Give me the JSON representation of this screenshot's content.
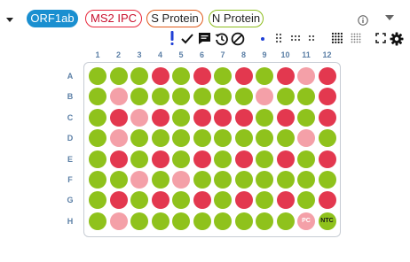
{
  "targets": [
    {
      "label": "ORF1ab",
      "fill": "#1a8fd0",
      "border": "#1a8fd0",
      "text": "#ffffff"
    },
    {
      "label": "MS2 IPC",
      "fill": "#ffffff",
      "border": "#e8273b",
      "text": "#c8102e"
    },
    {
      "label": "S Protein",
      "fill": "#ffffff",
      "border": "#e05a1a",
      "text": "#222222"
    },
    {
      "label": "N Protein",
      "fill": "#ffffff",
      "border": "#8dbd1e",
      "text": "#222222"
    }
  ],
  "toolbar": {
    "info_icon": "info-icon",
    "flag_icon": "exclamation-icon",
    "check_icon": "check-icon",
    "comment_icon": "comment-icon",
    "history_icon": "history-icon",
    "block_icon": "ban-icon",
    "fullscreen_icon": "expand-icon",
    "settings_icon": "gear-icon"
  },
  "colors": {
    "positive": "#e3384f",
    "weak": "#f4a0a8",
    "negative": "#8fc21c",
    "ntc_fill": "#8fc21c",
    "pc_fill": "#f4a0a8",
    "label": "#5b7fa6"
  },
  "plate": {
    "columns": [
      "1",
      "2",
      "3",
      "4",
      "5",
      "6",
      "7",
      "8",
      "9",
      "10",
      "11",
      "12"
    ],
    "rows": [
      {
        "label": "A",
        "wells": [
          "n",
          "n",
          "n",
          "p",
          "n",
          "p",
          "n",
          "p",
          "n",
          "p",
          "w",
          "p"
        ]
      },
      {
        "label": "B",
        "wells": [
          "n",
          "w",
          "n",
          "n",
          "n",
          "n",
          "n",
          "n",
          "w",
          "n",
          "n",
          "p"
        ]
      },
      {
        "label": "C",
        "wells": [
          "n",
          "p",
          "w",
          "p",
          "n",
          "p",
          "p",
          "p",
          "n",
          "p",
          "n",
          "p"
        ]
      },
      {
        "label": "D",
        "wells": [
          "n",
          "w",
          "n",
          "n",
          "n",
          "n",
          "n",
          "n",
          "n",
          "n",
          "w",
          "n"
        ]
      },
      {
        "label": "E",
        "wells": [
          "n",
          "p",
          "n",
          "p",
          "n",
          "p",
          "n",
          "p",
          "n",
          "p",
          "n",
          "p"
        ]
      },
      {
        "label": "F",
        "wells": [
          "n",
          "n",
          "w",
          "n",
          "w",
          "n",
          "n",
          "n",
          "n",
          "n",
          "n",
          "n"
        ]
      },
      {
        "label": "G",
        "wells": [
          "n",
          "p",
          "n",
          "p",
          "n",
          "p",
          "n",
          "p",
          "n",
          "p",
          "n",
          "p"
        ]
      },
      {
        "label": "H",
        "wells": [
          "n",
          "w",
          "n",
          "n",
          "n",
          "n",
          "n",
          "n",
          "n",
          "n",
          "PC",
          "NTC"
        ]
      }
    ]
  }
}
